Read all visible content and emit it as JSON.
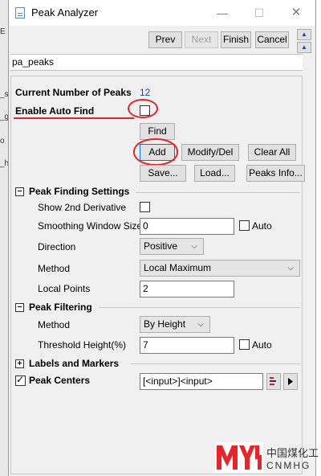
{
  "background_window": {
    "fragments": [
      "E",
      "_s",
      "_g",
      "o",
      "_h"
    ]
  },
  "window": {
    "title": "Peak Analyzer",
    "minimize_glyph": "—",
    "maximize_glyph": "☐",
    "close_glyph": "✕"
  },
  "nav": {
    "prev": "Prev",
    "next": "Next",
    "finish": "Finish",
    "cancel": "Cancel",
    "up_glyph": "▲",
    "down_glyph": "▲"
  },
  "page_name": "pa_peaks",
  "summary": {
    "current_peaks_label": "Current Number of Peaks",
    "current_peaks_value": "12",
    "auto_find_label": "Enable Auto Find",
    "auto_find_checked": false
  },
  "actions": {
    "find": "Find",
    "add": "Add",
    "modify": "Modify/Del",
    "clear": "Clear All",
    "save": "Save...",
    "load": "Load...",
    "info": "Peaks Info..."
  },
  "peak_finding": {
    "toggle": "−",
    "title": "Peak Finding Settings",
    "show_2nd_label": "Show 2nd Derivative",
    "smoothing_label": "Smoothing Window Size",
    "smoothing_value": "0",
    "smoothing_auto": "Auto",
    "direction_label": "Direction",
    "direction_value": "Positive",
    "method_label": "Method",
    "method_value": "Local Maximum",
    "local_points_label": "Local Points",
    "local_points_value": "2"
  },
  "peak_filtering": {
    "toggle": "−",
    "title": "Peak Filtering",
    "method_label": "Method",
    "method_value": "By Height",
    "threshold_label": "Threshold Height(%)",
    "threshold_value": "7",
    "threshold_auto": "Auto"
  },
  "labels_markers": {
    "toggle": "+",
    "title": "Labels and Markers"
  },
  "peak_centers": {
    "title": "Peak Centers",
    "value": "[<input>]<input>"
  },
  "watermark": {
    "logo": "MYH",
    "cn": "中国煤化工",
    "en": "CNMHG"
  },
  "colors": {
    "annotation": "#e8242a",
    "accent": "#0078d7",
    "value_blue": "#1c3fb0"
  },
  "icons": {
    "dialog": "dialog-icon",
    "up": "triangle-up-icon",
    "down": "triangle-up-icon",
    "picker": "range-picker-icon",
    "arrow": "play-arrow-icon",
    "chevron": "chevron-down-icon"
  }
}
